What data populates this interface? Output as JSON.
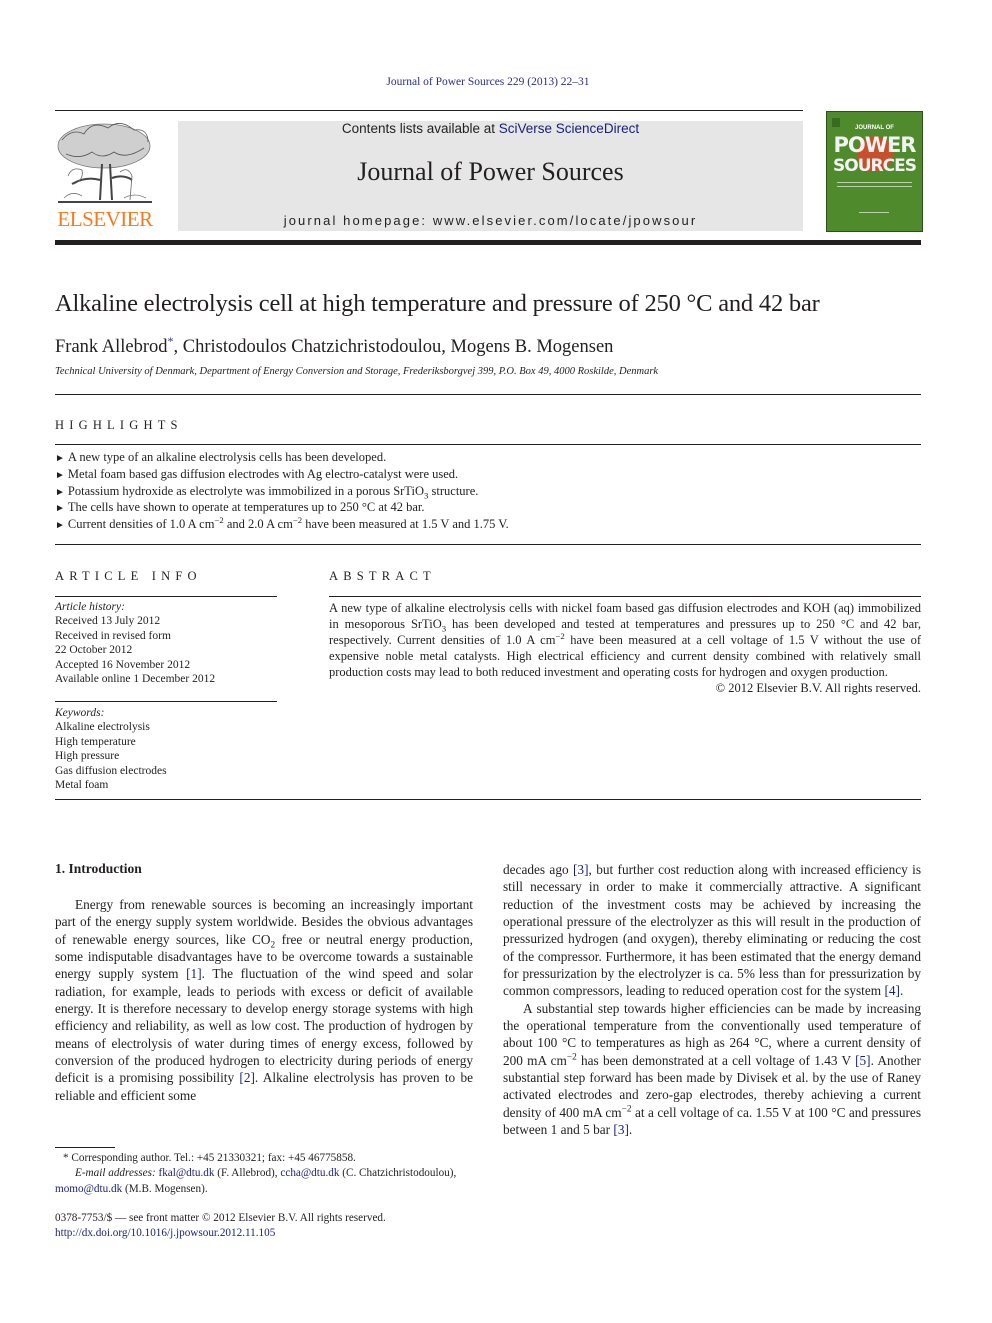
{
  "header": {
    "citation": "Journal of Power Sources 229 (2013) 22–31",
    "contents_prefix": "Contents lists available at ",
    "contents_link": "SciVerse ScienceDirect",
    "journal_title": "Journal of Power Sources",
    "homepage": "journal homepage: www.elsevier.com/locate/jpowsour",
    "publisher_logo_text": "ELSEVIER",
    "cover": {
      "line1": "JOURNAL OF",
      "line2": "POWER",
      "line3": "SOURCES",
      "color_bg": "#4f8a2c",
      "color_sun": "#c5502a"
    }
  },
  "article": {
    "title": "Alkaline electrolysis cell at high temperature and pressure of 250 °C and 42 bar",
    "authors": {
      "first": "Frank Allebrod",
      "star": "*",
      "rest": ", Christodoulos Chatzichristodoulou, Mogens B. Mogensen"
    },
    "affiliation": "Technical University of Denmark, Department of Energy Conversion and Storage, Frederiksborgvej 399, P.O. Box 49, 4000 Roskilde, Denmark"
  },
  "highlights": {
    "heading": "HIGHLIGHTS",
    "bullet": "►",
    "items": [
      "A new type of an alkaline electrolysis cells has been developed.",
      "Metal foam based gas diffusion electrodes with Ag electro-catalyst were used.",
      "Potassium hydroxide as electrolyte was immobilized in a porous SrTiO",
      "The cells have shown to operate at temperatures up to 250 °C at 42 bar.",
      "Current densities of 1.0 A cm"
    ],
    "item3_sub": "3",
    "item3_tail": " structure.",
    "item5_sup": "−2",
    "item5_mid": " and 2.0 A cm",
    "item5_sup2": "−2",
    "item5_tail": " have been measured at 1.5 V and 1.75 V."
  },
  "article_info": {
    "heading": "ARTICLE INFO",
    "history_label": "Article history:",
    "history": [
      "Received 13 July 2012",
      "Received in revised form",
      "22 October 2012",
      "Accepted 16 November 2012",
      "Available online 1 December 2012"
    ],
    "keywords_label": "Keywords:",
    "keywords": [
      "Alkaline electrolysis",
      "High temperature",
      "High pressure",
      "Gas diffusion electrodes",
      "Metal foam"
    ]
  },
  "abstract": {
    "heading": "ABSTRACT",
    "p1": "A new type of alkaline electrolysis cells with nickel foam based gas diffusion electrodes and KOH (aq) immobilized in mesoporous SrTiO",
    "p1_sub": "3",
    "p2": " has been developed and tested at temperatures and pressures up to 250 °C and 42 bar, respectively. Current densities of 1.0 A cm",
    "p2_sup": "−2",
    "p3": " have been measured at a cell voltage of 1.5 V without the use of expensive noble metal catalysts. High electrical efficiency and current density combined with relatively small production costs may lead to both reduced investment and operating costs for hydrogen and oxygen production.",
    "copyright": "© 2012 Elsevier B.V. All rights reserved."
  },
  "introduction": {
    "heading": "1.  Introduction",
    "left": {
      "a": "Energy from renewable sources is becoming an increasingly important part of the energy supply system worldwide. Besides the obvious advantages of renewable energy sources, like CO",
      "a_sub": "2",
      "b": " free or neutral energy production, some indisputable disadvantages have to be overcome towards a sustainable energy supply system ",
      "ref1": "[1]",
      "c": ". The fluctuation of the wind speed and solar radiation, for example, leads to periods with excess or deficit of available energy. It is therefore necessary to develop energy storage systems with high efficiency and reliability, as well as low cost. The production of hydrogen by means of electrolysis of water during times of energy excess, followed by conversion of the produced hydrogen to elec­tricity during periods of energy deficit is a promising possibility ",
      "ref2": "[2]",
      "d": ". Alkaline electrolysis has proven to be reliable and efficient some"
    },
    "right": {
      "a": "decades ago ",
      "ref3": "[3]",
      "b": ", but further cost reduction along with increased efficiency is still necessary in order to make it commercially attractive. A significant reduction of the investment costs may be achieved by increasing the operational pressure of the electrolyzer as this will result in the production of pressurized hydrogen (and oxygen), thereby eliminating or reducing the cost of the compressor. Furthermore, it has been estimated that the energy demand for pressurization by the electrolyzer is ca. 5% less than for pressurization by common compressors, leading to reduced oper­ation cost for the system ",
      "ref4": "[4]",
      "c": ".",
      "p2a": "A substantial step towards higher efficiencies can be made by increasing the operational temperature from the conventionally used temperature of about 100 °C to temperatures as high as 264 °C, where a current density of 200 mA cm",
      "p2a_sup": "−2",
      "p2b": " has been demonstrated at a cell voltage of 1.43 V ",
      "ref5": "[5]",
      "p2c": ". Another substantial step forward has been made by Divisek et al. by the use of Raney activated electrodes and zero-gap electrodes, thereby achieving a current density of 400 mA cm",
      "p2c_sup": "−2",
      "p2d": " at a cell voltage of ca. 1.55 V at 100 °C and pressures between 1 and 5 bar ",
      "ref3b": "[3]",
      "p2e": "."
    }
  },
  "footnotes": {
    "star": "*",
    "corresponding": " Corresponding author. Tel.: +45 21330321; fax: +45 46775858.",
    "email_label": "E-mail addresses:",
    "email1": "fkal@dtu.dk",
    "email1_name": " (F. Allebrod), ",
    "email2": "ccha@dtu.dk",
    "email2_name": " (C. Chatzichristodoulou),",
    "email3": "momo@dtu.dk",
    "email3_name": " (M.B. Mogensen).",
    "front_matter": "0378-7753/$ — see front matter © 2012 Elsevier B.V. All rights reserved.",
    "doi": "http://dx.doi.org/10.1016/j.jpowsour.2012.11.105"
  }
}
